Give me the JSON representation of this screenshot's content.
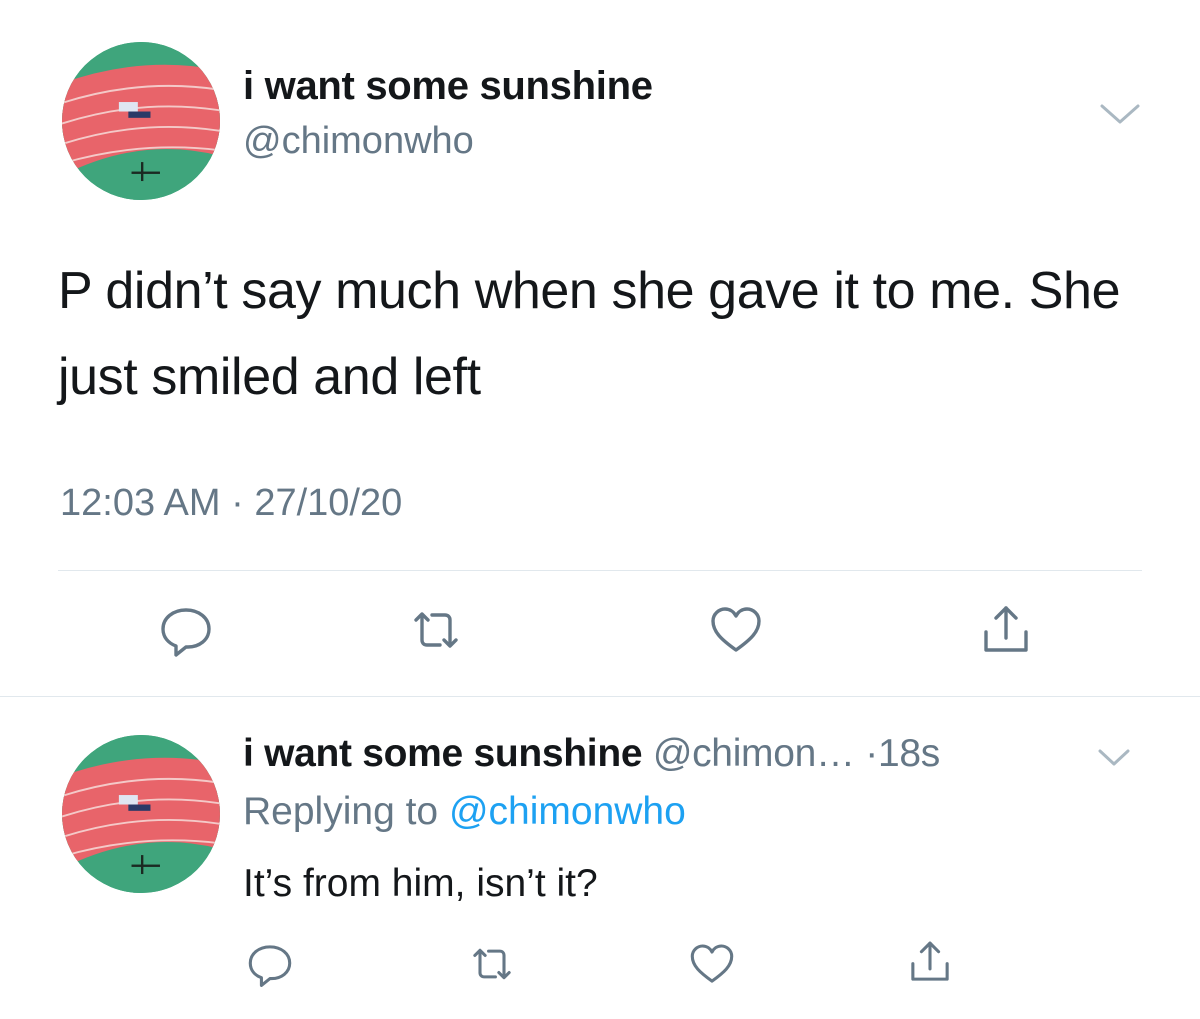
{
  "main_tweet": {
    "display_name": "i want some sunshine",
    "handle": "@chimonwho",
    "text": "P didn’t say much when she gave it to me. She just smiled and left",
    "timestamp": "12:03 AM · 27/10/20"
  },
  "reply_tweet": {
    "display_name": "i want some sunshine",
    "handle": "@chimon…",
    "separator": " ·",
    "age": "18s",
    "replying_prefix": "Replying to ",
    "replying_to": "@chimonwho",
    "text": "It’s from him, isn’t it?"
  },
  "icons": {
    "reply": "comment-icon",
    "retweet": "retweet-icon",
    "like": "heart-icon",
    "share": "share-icon",
    "menu": "chevron-down-icon"
  },
  "colors": {
    "text": "#14171a",
    "secondary": "#657786",
    "link": "#1da1f2",
    "divider": "#e1e8ed",
    "caret": "#aab8c2",
    "avatar_track": "#e8646a",
    "avatar_field": "#3fa57c"
  }
}
